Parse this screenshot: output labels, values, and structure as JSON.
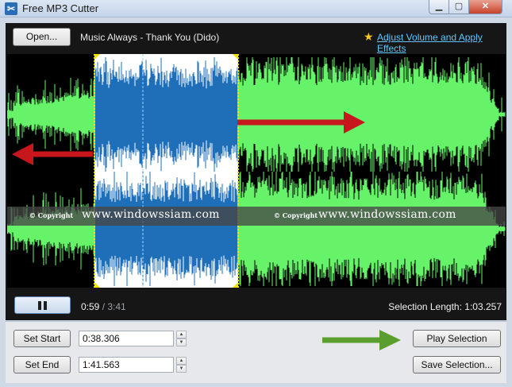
{
  "window": {
    "title": "Free MP3 Cutter",
    "icon": "scissors-icon"
  },
  "toolbar": {
    "open_label": "Open...",
    "track_title": "Music Always - Thank You (Dido)",
    "effects_link": "Adjust Volume and Apply Effects",
    "effects_icon": "star-icon"
  },
  "waveform": {
    "wave_color": "#66f36a",
    "selection_bg": "#ffffff",
    "selection_wave_color": "#1f6fb8",
    "selection_marker_color": "#f2e100",
    "arrow_color": "#c8161d",
    "watermark": {
      "copyright": "© Copyright",
      "url": "www.windowssiam.com"
    }
  },
  "transport": {
    "pause_icon": "pause-icon",
    "current_time": "0:59",
    "separator": " / ",
    "total_time": "3:41",
    "selection_length_label": "Selection Length:",
    "selection_length_value": "1:03.257"
  },
  "controls": {
    "set_start_label": "Set Start",
    "set_end_label": "Set End",
    "start_value": "0:38.306",
    "end_value": "1:41.563",
    "play_selection_label": "Play Selection",
    "save_selection_label": "Save Selection...",
    "arrow_color": "#5a9e2e"
  }
}
